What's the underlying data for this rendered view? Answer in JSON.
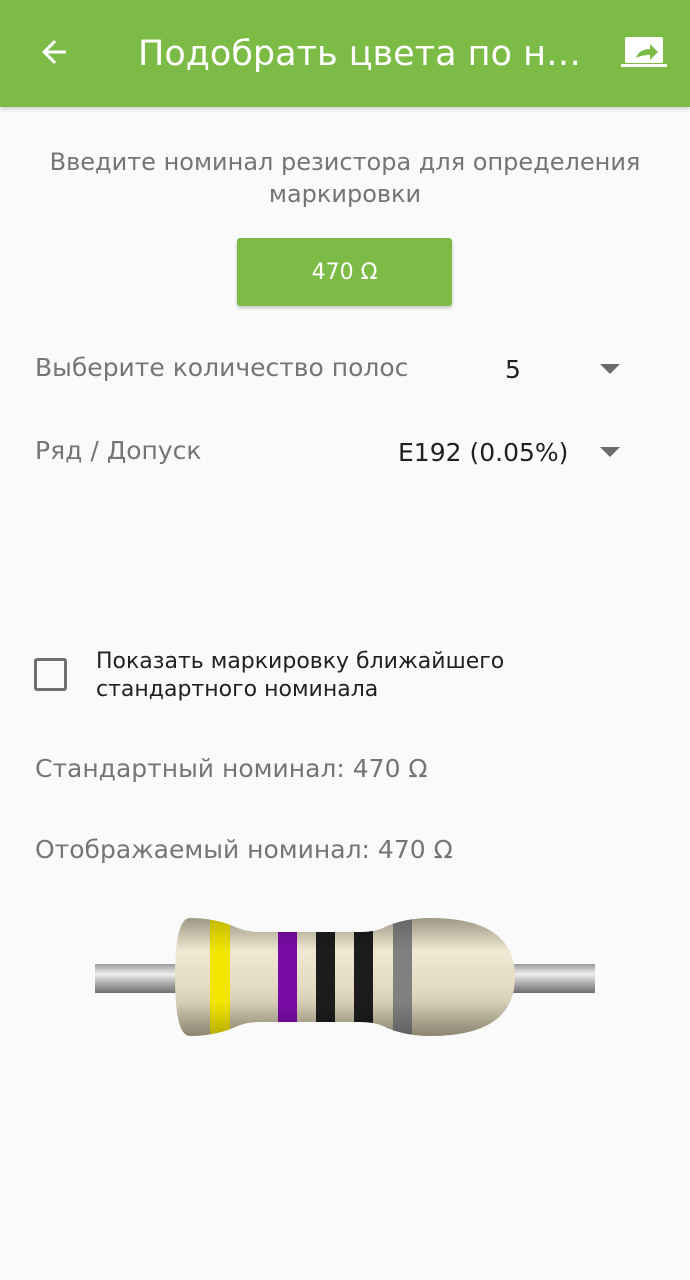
{
  "app_bar": {
    "title": "Подобрать цвета по но...",
    "back_icon": "arrow-left-icon",
    "share_icon": "share-screen-icon",
    "color": "#7cbb45"
  },
  "intro_text": "Введите номинал резистора для определения маркировки",
  "value_button": "470 Ω",
  "bands_count": {
    "label": "Выберите количество полос",
    "value": "5"
  },
  "series_tolerance": {
    "label": "Ряд / Допуск",
    "value": "E192 (0.05%)"
  },
  "nearest_standard_checkbox": {
    "label": "Показать маркировку ближайшего стандартного номинала",
    "checked": false
  },
  "standard_value": "Стандартный номинал: 470 Ω",
  "displayed_value": "Отображаемый номинал: 470 Ω",
  "resistor": {
    "body_color": "#e3dcc4",
    "band_colors": [
      "#f2e600",
      "#7a0aa6",
      "#1c1c1c",
      "#1c1c1c",
      "#808080"
    ]
  }
}
